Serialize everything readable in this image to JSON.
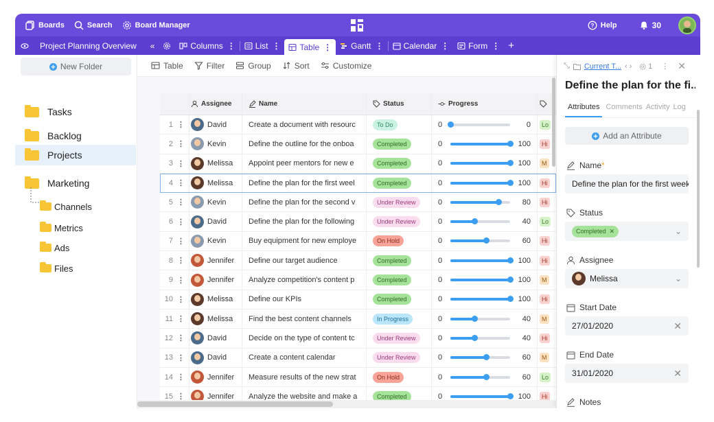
{
  "topbar": {
    "boards_label": "Boards",
    "search_label": "Search",
    "board_manager_label": "Board Manager",
    "help_label": "Help",
    "notification_count": "30"
  },
  "viewbar": {
    "board_title": "Project Planning Overview",
    "tabs": [
      {
        "label": "Columns"
      },
      {
        "label": "List"
      },
      {
        "label": "Table"
      },
      {
        "label": "Gantt"
      },
      {
        "label": "Calendar"
      },
      {
        "label": "Form"
      }
    ],
    "add_label": "+"
  },
  "sidebar": {
    "new_folder_label": "New Folder",
    "folders": [
      {
        "label": "Tasks"
      },
      {
        "label": "Backlog"
      },
      {
        "label": "Projects"
      },
      {
        "label": "Marketing"
      },
      {
        "label": "Channels"
      },
      {
        "label": "Metrics"
      },
      {
        "label": "Ads"
      },
      {
        "label": "Files"
      }
    ]
  },
  "toolbar": {
    "table_label": "Table",
    "filter_label": "Filter",
    "group_label": "Group",
    "sort_label": "Sort",
    "customize_label": "Customize"
  },
  "table": {
    "headers": {
      "assignee": "Assignee",
      "name": "Name",
      "status": "Status",
      "progress": "Progress"
    },
    "rows": [
      {
        "num": "1",
        "assignee": "David",
        "name": "Create a document with resourc",
        "status": "To Do",
        "min": "0",
        "value": 0,
        "pri": "Lo"
      },
      {
        "num": "2",
        "assignee": "Kevin",
        "name": "Define the outline for the onboa",
        "status": "Completed",
        "min": "0",
        "value": 100,
        "pri": "Hi"
      },
      {
        "num": "3",
        "assignee": "Melissa",
        "name": "Appoint peer mentors for new e",
        "status": "Completed",
        "min": "0",
        "value": 100,
        "pri": "M"
      },
      {
        "num": "4",
        "assignee": "Melissa",
        "name": "Define the plan for the first weel",
        "status": "Completed",
        "min": "0",
        "value": 100,
        "pri": "Hi"
      },
      {
        "num": "5",
        "assignee": "Kevin",
        "name": "Define the plan for the second v",
        "status": "Under Review",
        "min": "0",
        "value": 80,
        "pri": "Hi"
      },
      {
        "num": "6",
        "assignee": "David",
        "name": "Define the plan for the following",
        "status": "Under Review",
        "min": "0",
        "value": 40,
        "pri": "Lo"
      },
      {
        "num": "7",
        "assignee": "Kevin",
        "name": "Buy equipment for new employe",
        "status": "On Hold",
        "min": "0",
        "value": 60,
        "pri": "Hi"
      },
      {
        "num": "8",
        "assignee": "Jennifer",
        "name": "Define our target audience",
        "status": "Completed",
        "min": "0",
        "value": 100,
        "pri": "Hi"
      },
      {
        "num": "9",
        "assignee": "Jennifer",
        "name": "Analyze competition's content p",
        "status": "Completed",
        "min": "0",
        "value": 100,
        "pri": "M"
      },
      {
        "num": "10",
        "assignee": "Melissa",
        "name": "Define our KPIs",
        "status": "Completed",
        "min": "0",
        "value": 100,
        "pri": "Hi"
      },
      {
        "num": "11",
        "assignee": "Melissa",
        "name": "Find the best content channels",
        "status": "In Progress",
        "min": "0",
        "value": 40,
        "pri": "M"
      },
      {
        "num": "12",
        "assignee": "David",
        "name": "Decide on the type of content tc",
        "status": "Under Review",
        "min": "0",
        "value": 40,
        "pri": "Hi"
      },
      {
        "num": "13",
        "assignee": "David",
        "name": "Create a content calendar",
        "status": "Under Review",
        "min": "0",
        "value": 60,
        "pri": "M"
      },
      {
        "num": "14",
        "assignee": "Jennifer",
        "name": "Measure results of the new strat",
        "status": "On Hold",
        "min": "0",
        "value": 60,
        "pri": "Lo"
      },
      {
        "num": "15",
        "assignee": "Jennifer",
        "name": "Analyze the website and make a",
        "status": "Completed",
        "min": "0",
        "value": 100,
        "pri": "Hi"
      }
    ]
  },
  "status_colors": {
    "To Do": {
      "bg": "#c9f2e2",
      "fg": "#2f8a68"
    },
    "Completed": {
      "bg": "#a6e39a",
      "fg": "#2f6b25"
    },
    "Under Review": {
      "bg": "#fbdcef",
      "fg": "#9b3d7a"
    },
    "On Hold": {
      "bg": "#f7a398",
      "fg": "#8a2a1e"
    },
    "In Progress": {
      "bg": "#b9e6fb",
      "fg": "#1f6f98"
    }
  },
  "priority_colors": {
    "Lo": {
      "bg": "#d6f2c9",
      "fg": "#3f7a2c"
    },
    "Hi": {
      "bg": "#f9d2cf",
      "fg": "#a3372c"
    },
    "M": {
      "bg": "#fbe2c2",
      "fg": "#9a5a17"
    }
  },
  "avatar_colors": {
    "David": "#4a6b8a",
    "Kevin": "#8a9bb0",
    "Melissa": "#5b3a2c",
    "Jennifer": "#c2573a"
  },
  "panel": {
    "breadcrumb": "Current T...",
    "watch_count": "1",
    "title": "Define the plan for the fi...",
    "tab_attributes": "Attributes",
    "tab_comments": "Comments",
    "tab_activity": "Activity",
    "tab_log": "Log",
    "add_attribute_label": "Add an Attribute",
    "name_label": "Name",
    "name_required": "*",
    "name_value": "Define the plan for the first week",
    "status_label": "Status",
    "status_value": "Completed",
    "assignee_label": "Assignee",
    "assignee_value": "Melissa",
    "start_date_label": "Start Date",
    "start_date_value": "27/01/2020",
    "end_date_label": "End Date",
    "end_date_value": "31/01/2020",
    "notes_label": "Notes"
  },
  "colors": {
    "topbar": "#6b4bdc",
    "viewbar": "#5c3fd0",
    "accent": "#3b9ef0"
  }
}
